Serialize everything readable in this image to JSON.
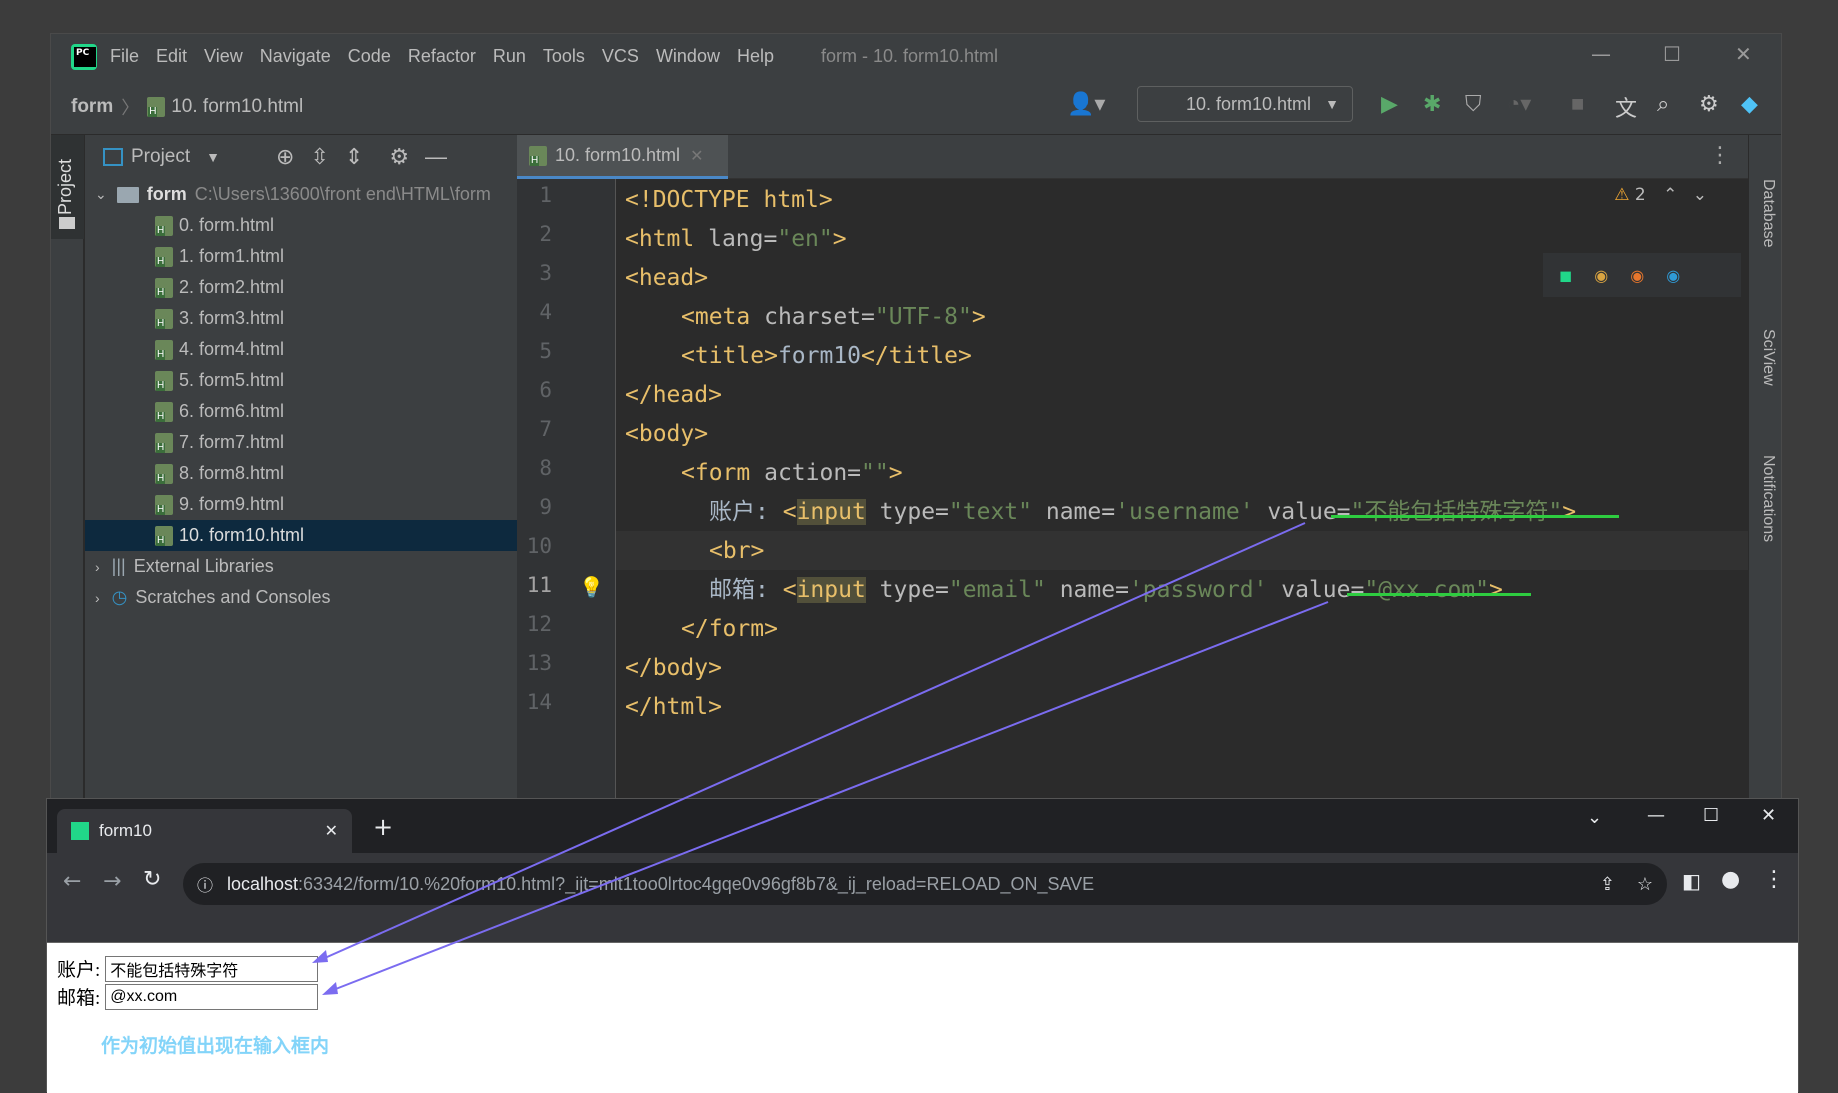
{
  "menu": [
    "File",
    "Edit",
    "View",
    "Navigate",
    "Code",
    "Refactor",
    "Run",
    "Tools",
    "VCS",
    "Window",
    "Help"
  ],
  "window_title": "form - 10. form10.html",
  "breadcrumb": {
    "root": "form",
    "file": "10. form10.html"
  },
  "run_config": "10. form10.html",
  "project": {
    "header": "Project",
    "root_name": "form",
    "root_path": "C:\\Users\\13600\\front end\\HTML\\form",
    "files": [
      "0. form.html",
      "1. form1.html",
      "2. form2.html",
      "3. form3.html",
      "4. form4.html",
      "5. form5.html",
      "6. form6.html",
      "7. form7.html",
      "8. form8.html",
      "9. form9.html",
      "10. form10.html"
    ],
    "external": "External Libraries",
    "scratches": "Scratches and Consoles"
  },
  "side_tabs": {
    "left": "Project",
    "database": "Database",
    "sciview": "SciView",
    "notifications": "Notifications"
  },
  "editor": {
    "tab": "10. form10.html",
    "warnings": "2",
    "line_numbers": [
      "1",
      "2",
      "3",
      "4",
      "5",
      "6",
      "7",
      "8",
      "9",
      "10",
      "11",
      "12",
      "13",
      "14"
    ],
    "lines": {
      "l1": "<!DOCTYPE html>",
      "l2a": "<html ",
      "l2b": "lang=",
      "l2c": "\"en\"",
      "l2d": ">",
      "l3": "<head>",
      "l4a": "<meta ",
      "l4b": "charset=",
      "l4c": "\"UTF-8\"",
      "l4d": ">",
      "l5a": "<title>",
      "l5b": "form10",
      "l5c": "</title>",
      "l6": "</head>",
      "l7": "<body>",
      "l8a": "<form ",
      "l8b": "action=",
      "l8c": "\"\"",
      "l8d": ">",
      "l9a": "账户: ",
      "l9b": "<",
      "l9c": "input",
      "l9d": " type=",
      "l9e": "\"text\"",
      "l9f": " name=",
      "l9g": "'username'",
      "l9h": " value=",
      "l9i": "\"不能包括特殊字符\"",
      "l9j": ">",
      "l10": "<br>",
      "l11a": "邮箱: ",
      "l11b": "<",
      "l11c": "input",
      "l11d": " type=",
      "l11e": "\"email\"",
      "l11f": " name=",
      "l11g": "'password'",
      "l11h": " value=",
      "l11i": "\"@xx.com\"",
      "l11j": ">",
      "l12": "</form>",
      "l13": "</body>",
      "l14": "</html>"
    }
  },
  "browser": {
    "tab_title": "form10",
    "url_host": "localhost",
    "url_rest": ":63342/form/10.%20form10.html?_ijt=mlt1too0lrtoc4gqe0v96gf8b7&_ij_reload=RELOAD_ON_SAVE",
    "account_label": "账户:",
    "account_value": "不能包括特殊字符",
    "email_label": "邮箱:",
    "email_value": "@xx.com",
    "note": "作为初始值出现在输入框内"
  }
}
